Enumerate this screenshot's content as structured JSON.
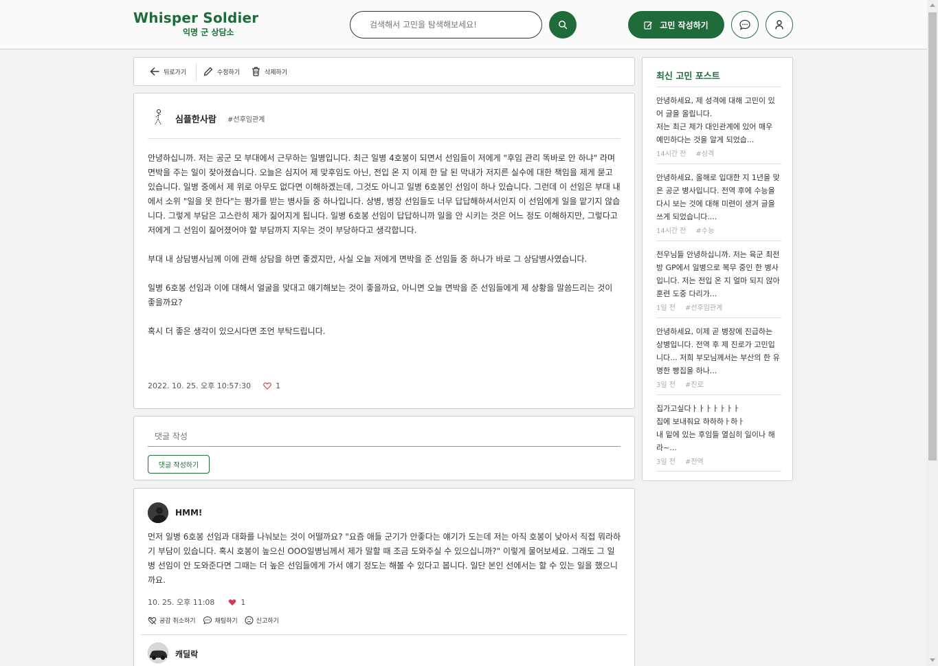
{
  "header": {
    "logo_title": "Whisper Soldier",
    "logo_subtitle": "익명 군 상담소",
    "search_placeholder": "검색해서 고민을 탐색해보세요!",
    "write_label": "고민 작성하기"
  },
  "toolbar": {
    "back_label": "뒤로가기",
    "edit_label": "수정하기",
    "delete_label": "삭제하기"
  },
  "post": {
    "author": "심플한사람",
    "tag": "#선후임관계",
    "paragraphs": [
      "안녕하십니까. 저는 공군 모 부대에서 근무하는 일병입니다. 최근 일병 4호봉이 되면서 선임들이 저에게 \"후임 관리 똑바로 안 하냐\" 라며 면박을 주는 일이 잦아졌습니다. 오늘은 심지어 제 맞후임도 아닌, 전입 온 지 이제 한 달 된 막내가 저지른 실수에 대한 책임을 제게 묻고 있습니다. 일병 중에서 제 위로 아무도 없다면 이해하겠는데, 그것도 아니고 일병 6호봉인 선임이 하나 있습니다. 그런데 이 선임은 부대 내에서 소위 \"일을 못 한다\"는 평가를 받는 병사들 중 하나입니다. 상병, 병장 선임들도 너무 답답해하셔서인지 이 선임에게 일을 맡기지 않습니다. 그렇게 부담은 고스란히 제가 짊어지게 됩니다. 일병 6호봉 선임이 답답하니까 일을 안 시키는 것은 어느 정도 이해하지만, 그렇다고 저에게 그 선임이 짊어졌어야 할 부담까지 지우는 것이 부당하다고 생각합니다.",
      "부대 내 상담병사님께 이에 관해 상담을 하면 좋겠지만, 사실 오늘 저에게 면박을 준 선임들 중 하나가 바로 그 상담병사였습니다.",
      "일병 6호봉 선임과 이에 대해서 얼굴을 맞대고 얘기해보는 것이 좋을까요, 아니면 오늘 면박을 준 선임들에게 제 상황을 말씀드리는 것이 좋을까요?",
      "혹시 더 좋은 생각이 있으시다면 조언 부탁드립니다."
    ],
    "date": "2022. 10. 25. 오후 10:57:30",
    "likes": "1"
  },
  "comment_form": {
    "placeholder": "댓글 작성",
    "submit_label": "댓글 작성하기"
  },
  "comments": [
    {
      "author": "HMM!",
      "body": "먼저 일병 6호봉 선임과 대화를 나눠보는 것이 어떨까요? \"요즘 애들 군기가 안좋다는 얘기가 도는데 저는 아직 호봉이 낮아서 직접 뭐라하기 부담이 있습니다. 혹시 호봉이 높으신 OOO일병님께서 제가 말할 때 조금 도와주실 수 있으십니까?\" 이렇게 물어보세요. 그래도 그 일병 선임이 안 도와준다면 그때는 더 높은 선임들에게 가서 얘기 정도는 해볼 수 있다고 봅니다. 일단 본인 선에서는 할 수 있는 일을 했으니까요.",
      "date": "10. 25. 오후 11:08",
      "likes": "1",
      "actions": [
        "공감 취소하기",
        "채팅하기",
        "신고하기"
      ]
    },
    {
      "author": "캐딜락"
    }
  ],
  "sidebar": {
    "title": "최신 고민 포스트",
    "items": [
      {
        "text": "안녕하세요, 제 성격에 대해 고민이 있어 글을 올립니다.\n저는 최근 제가 대인관계에 있어 매우 예민하다는 것을 알게 되었습...",
        "time": "14시간 전",
        "tag": "#성격"
      },
      {
        "text": "안녕하세요, 올해로 입대한 지 1년을 맞은 공군 병사입니다. 전역 후에 수능을 다시 보는 것에 대해 미련이 생겨 글을 쓰게 되었습니다....",
        "time": "14시간 전",
        "tag": "#수능"
      },
      {
        "text": "전우님들 안녕하십니까. 저는 육군 최전방 GP에서 일병으로 복무 중인 한 병사입니다. 저는 전입 온 지 얼마 되지 않아 훈련 도중 다리가...",
        "time": "1일 전",
        "tag": "#선후임관계"
      },
      {
        "text": "안녕하세요, 이제 곧 병장에 진급하는 상병입니다. 전역 후 제 진로가 고민입니다... 저희 부모님께서는 부산의 한 유명한 빵집을 하나...",
        "time": "3일 전",
        "tag": "#진로"
      },
      {
        "text": "집가고싶다ㅏㅏㅏㅏㅏㅏㅏ\n집에 보내줘요 하하하ㅏ하ㅏ\n내 밑에 있는 후임들 열심히 일이나 해라~...",
        "time": "3일 전",
        "tag": "#전역"
      }
    ]
  },
  "colors": {
    "brand": "#1f6b3a",
    "like": "#d9384a"
  }
}
